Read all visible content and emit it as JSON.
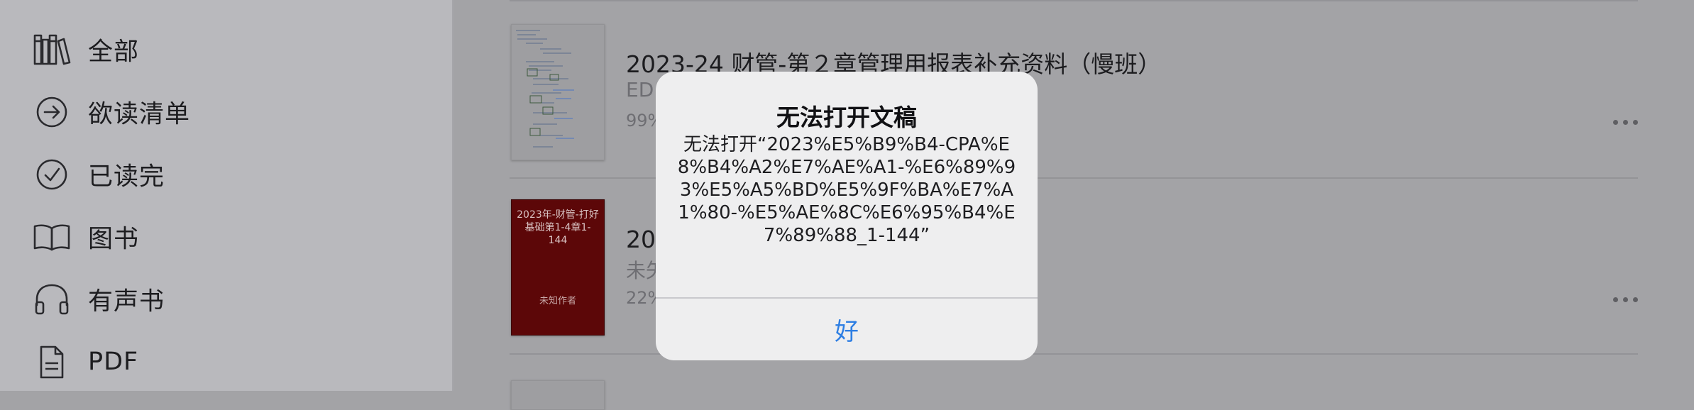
{
  "sidebar": {
    "items": [
      {
        "label": "全部",
        "icon": "library-icon"
      },
      {
        "label": "欲读清单",
        "icon": "arrow-circle-icon"
      },
      {
        "label": "已读完",
        "icon": "checkmark-circle-icon"
      },
      {
        "label": "图书",
        "icon": "book-icon"
      },
      {
        "label": "有声书",
        "icon": "headphones-icon"
      },
      {
        "label": "PDF",
        "icon": "document-icon"
      }
    ]
  },
  "books": [
    {
      "title": "2023-24 财管-第２章管理用报表补充资料（慢班）",
      "subtitle": "ED",
      "progress": "99%"
    },
    {
      "title": "20",
      "subtitle": "未矢",
      "progress": "22%",
      "cover_title": "2023年-财管-打好基础第1-4章1-144",
      "cover_author": "未知作者"
    }
  ],
  "alert": {
    "title": "无法打开文稿",
    "message": "无法打开“2023%E5%B9%B4-CPA%E8%B4%A2%E7%AE%A1-%E6%89%93%E5%A5%BD%E5%9F%BA%E7%A1%80-%E5%AE%8C%E6%95%B4%E7%89%88_1-144”",
    "ok_label": "好"
  },
  "colors": {
    "accent": "#2d7ee3",
    "cover_red": "#5c0708"
  }
}
